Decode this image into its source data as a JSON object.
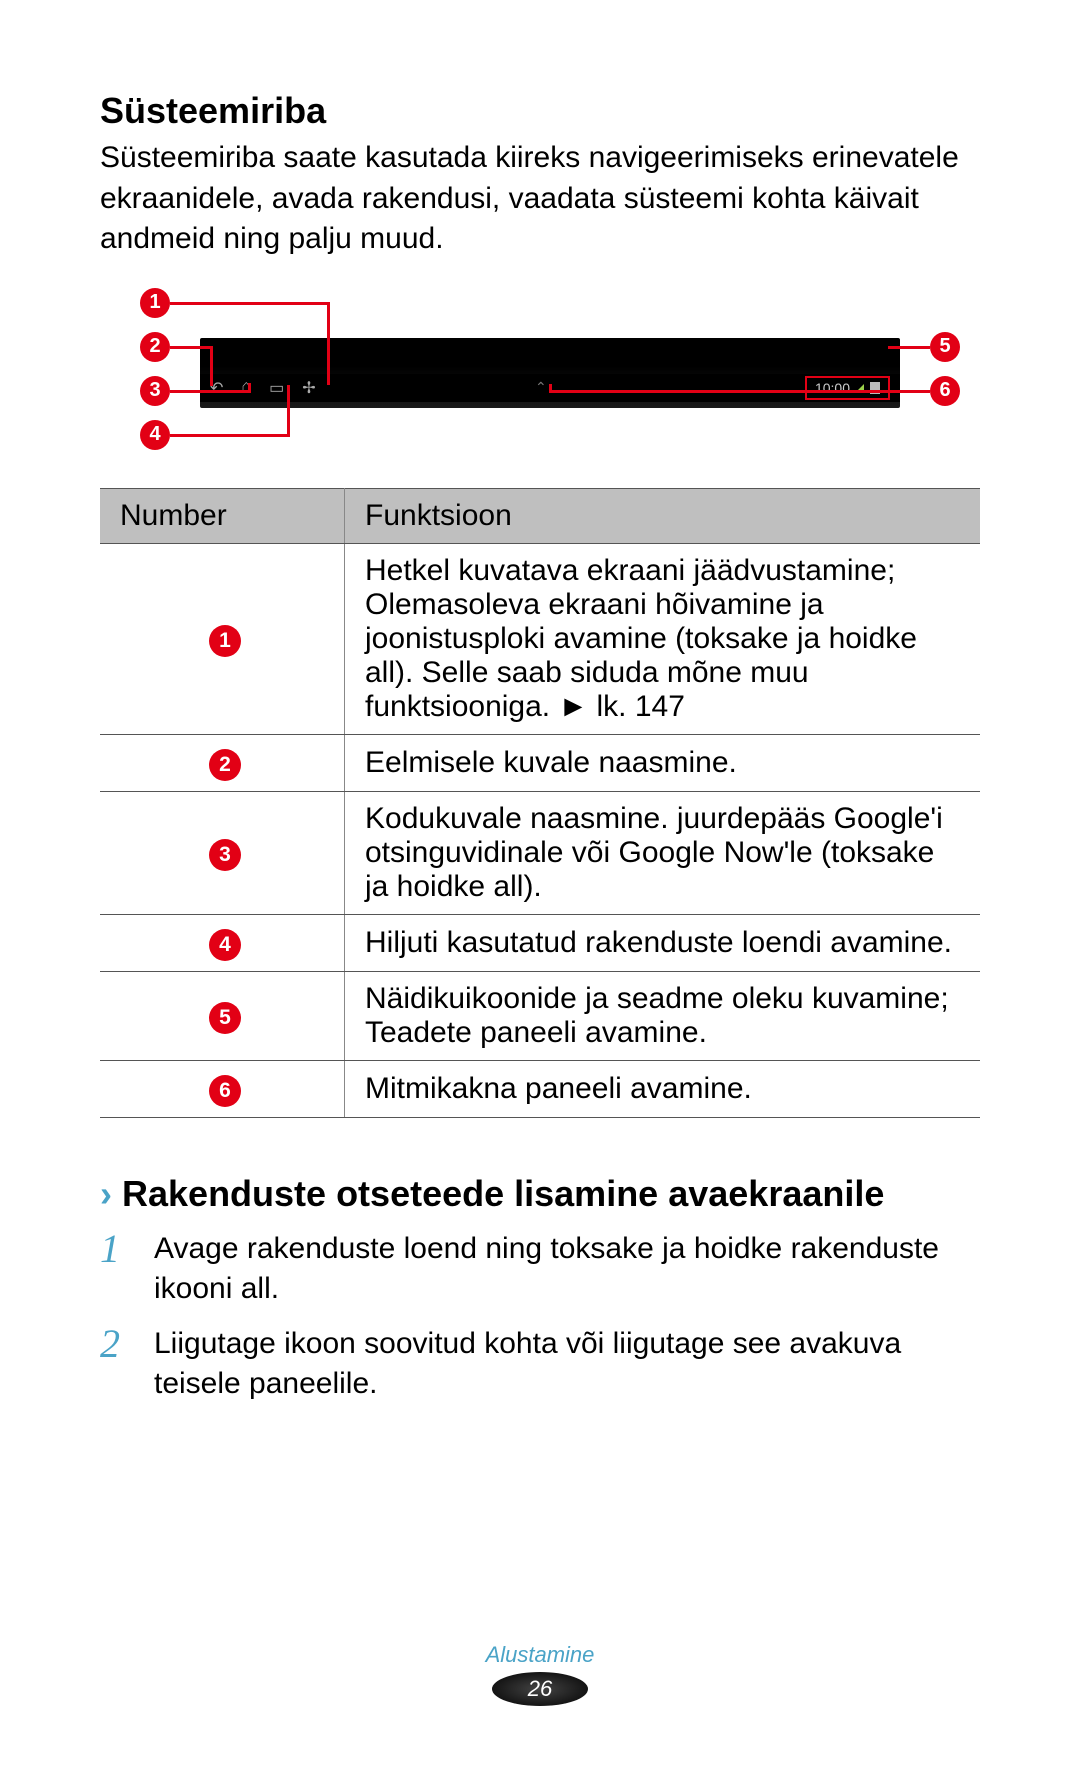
{
  "section": {
    "title": "Süsteemiriba",
    "intro": "Süsteemiriba saate kasutada kiireks navigeerimiseks erinevatele ekraanidele, avada rakendusi, vaadata süsteemi kohta käivait andmeid ning palju muud."
  },
  "diagram": {
    "status_time": "10:00",
    "callouts": [
      "1",
      "2",
      "3",
      "4",
      "5",
      "6"
    ]
  },
  "table": {
    "header_number": "Number",
    "header_function": "Funktsioon",
    "rows": [
      {
        "n": "1",
        "fn": "Hetkel kuvatava ekraani jäädvustamine; Olemasoleva ekraani hõivamine ja joonistusploki avamine (toksake ja hoidke all). Selle saab siduda mõne muu funktsiooniga. ► lk. 147"
      },
      {
        "n": "2",
        "fn": "Eelmisele kuvale naasmine."
      },
      {
        "n": "3",
        "fn": "Kodukuvale naasmine. juurdepääs Google'i otsinguvidinale või Google Now'le (toksake ja hoidke all)."
      },
      {
        "n": "4",
        "fn": "Hiljuti kasutatud rakenduste loendi avamine."
      },
      {
        "n": "5",
        "fn": "Näidikuikoonide ja seadme oleku kuvamine; Teadete paneeli avamine."
      },
      {
        "n": "6",
        "fn": "Mitmikakna paneeli avamine."
      }
    ]
  },
  "sub": {
    "chevron": "›",
    "title": "Rakenduste otseteede lisamine avaekraanile",
    "steps": [
      {
        "n": "1",
        "text": "Avage rakenduste loend ning toksake ja hoidke rakenduste ikooni all."
      },
      {
        "n": "2",
        "text": "Liigutage ikoon soovitud kohta või liigutage see avakuva teisele paneelile."
      }
    ]
  },
  "footer": {
    "label": "Alustamine",
    "page": "26"
  }
}
